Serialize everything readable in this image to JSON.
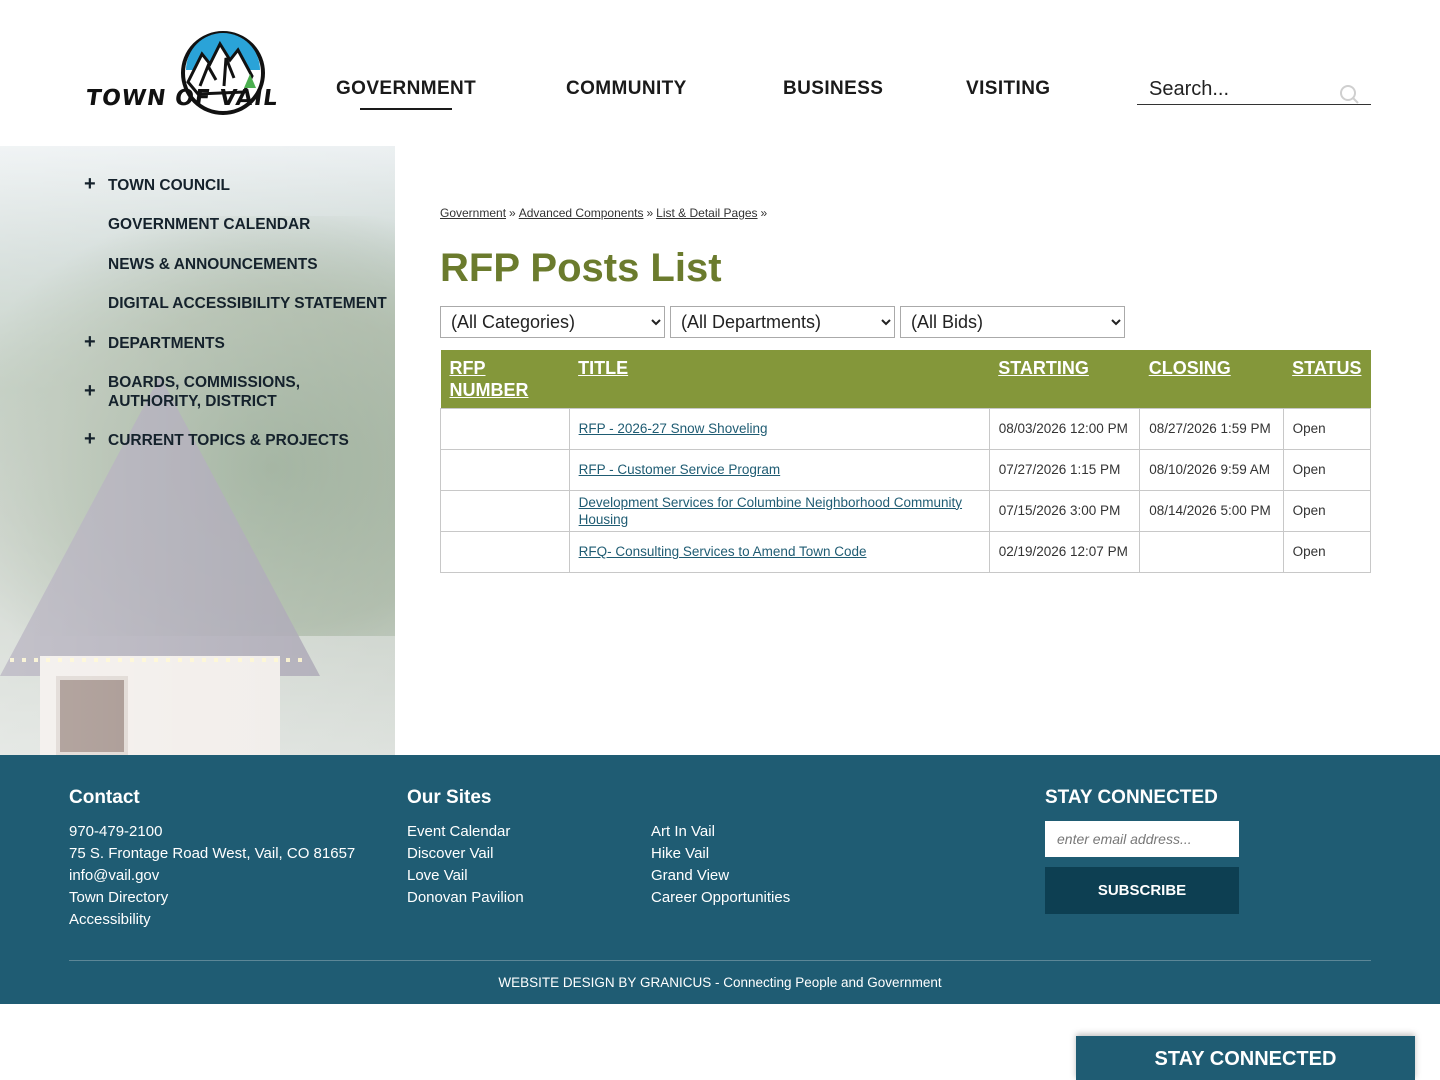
{
  "header": {
    "logo_text": "TOWN OF VAIL",
    "nav": [
      "GOVERNMENT",
      "COMMUNITY",
      "BUSINESS",
      "VISITING"
    ],
    "search_placeholder": "Search..."
  },
  "sidebar": {
    "items": [
      {
        "label": "TOWN COUNCIL",
        "expandable": true
      },
      {
        "label": "GOVERNMENT CALENDAR",
        "expandable": false
      },
      {
        "label": "NEWS & ANNOUNCEMENTS",
        "expandable": false
      },
      {
        "label": "DIGITAL ACCESSIBILITY STATEMENT",
        "expandable": false
      },
      {
        "label": "DEPARTMENTS",
        "expandable": true
      },
      {
        "label": "BOARDS, COMMISSIONS, AUTHORITY, DISTRICT",
        "expandable": true
      },
      {
        "label": "CURRENT TOPICS & PROJECTS",
        "expandable": true
      }
    ],
    "plus_glyph": "+"
  },
  "breadcrumb": {
    "items": [
      "Government",
      "Advanced Components",
      "List & Detail Pages"
    ],
    "separator": "»"
  },
  "page_title": "RFP Posts List",
  "filters": [
    "(All Categories)",
    "(All Departments)",
    "(All Bids)"
  ],
  "table": {
    "headers": [
      "RFP NUMBER",
      "TITLE",
      "STARTING",
      "CLOSING",
      "STATUS"
    ],
    "rows": [
      {
        "number": "",
        "title": "RFP - 2026-27 Snow Shoveling",
        "starting": "08/03/2026 12:00 PM",
        "closing": "08/27/2026 1:59 PM",
        "status": "Open"
      },
      {
        "number": "",
        "title": "RFP - Customer Service Program",
        "starting": "07/27/2026 1:15 PM",
        "closing": "08/10/2026 9:59 AM",
        "status": "Open"
      },
      {
        "number": "",
        "title": "Development Services for Columbine Neighborhood Community Housing",
        "starting": "07/15/2026 3:00 PM",
        "closing": "08/14/2026 5:00 PM",
        "status": "Open"
      },
      {
        "number": "",
        "title": "RFQ- Consulting Services to Amend Town Code",
        "starting": "02/19/2026 12:07 PM",
        "closing": "",
        "status": "Open"
      }
    ]
  },
  "footer": {
    "contact": {
      "heading": "Contact",
      "lines": [
        "970-479-2100",
        "75 S. Frontage Road West, Vail, CO 81657",
        "info@vail.gov",
        "Town Directory",
        "Accessibility"
      ]
    },
    "our_sites": {
      "heading": "Our Sites",
      "col1": [
        "Event Calendar",
        "Discover Vail",
        "Love Vail",
        "Donovan Pavilion"
      ],
      "col2": [
        "Art In Vail",
        "Hike Vail",
        "Grand View",
        "Career Opportunities"
      ]
    },
    "stay_connected": {
      "heading": "STAY CONNECTED",
      "email_placeholder": "enter email address...",
      "subscribe_label": "SUBSCRIBE"
    },
    "credit": "WEBSITE DESIGN BY GRANICUS - Connecting People and Government"
  },
  "sticky_tab": "STAY CONNECTED",
  "colors": {
    "title_green": "#6b7b2d",
    "table_header_green": "#84973a",
    "footer_blue": "#1f5c73",
    "subscribe_navy": "#0d3f52",
    "link_blue": "#1f5c73"
  }
}
